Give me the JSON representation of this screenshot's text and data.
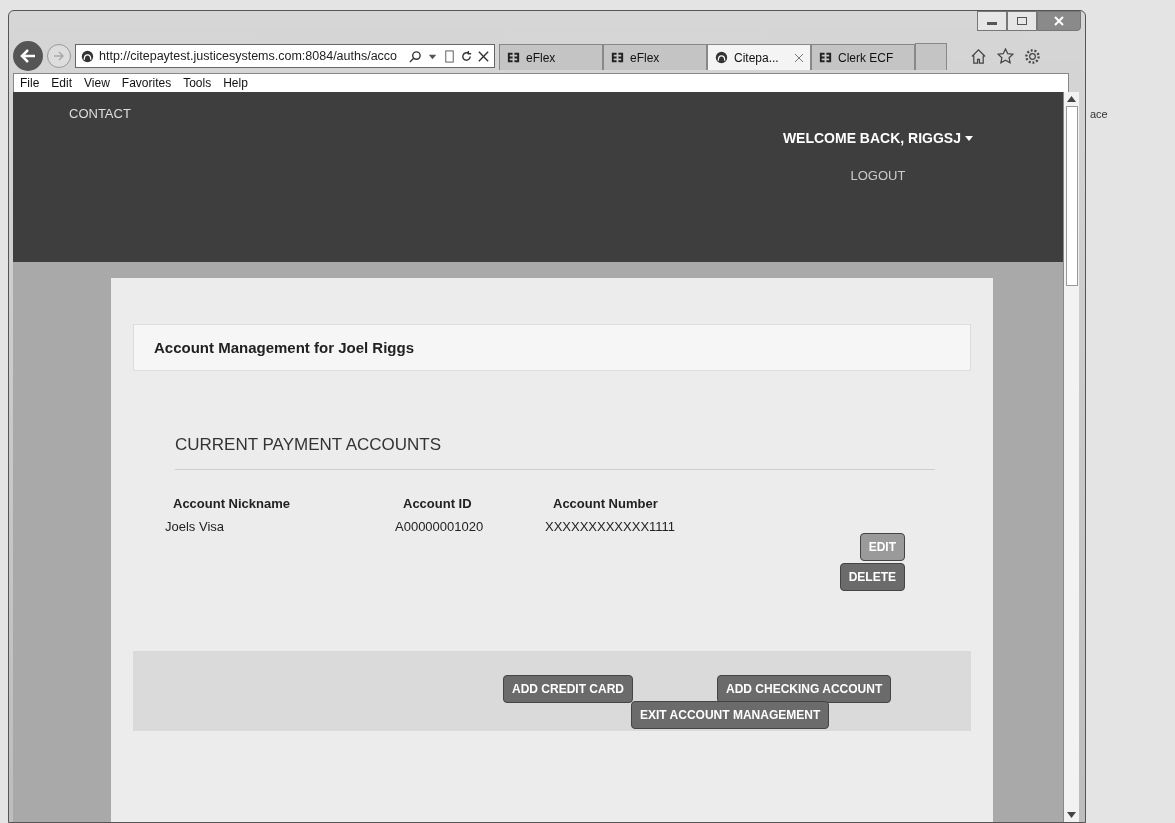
{
  "browser": {
    "address": "http://citepaytest.justicesystems.com:8084/auths/acco",
    "tabs": [
      {
        "label": "eFlex",
        "kind": "eflex",
        "selected": false
      },
      {
        "label": "eFlex",
        "kind": "eflex",
        "selected": false
      },
      {
        "label": "Citepa...",
        "kind": "globe",
        "selected": true
      },
      {
        "label": "Clerk ECF",
        "kind": "eflex",
        "selected": false
      }
    ],
    "menu": [
      "File",
      "Edit",
      "View",
      "Favorites",
      "Tools",
      "Help"
    ]
  },
  "background_window": {
    "text": "ace"
  },
  "header": {
    "nav_link": "CONTACT",
    "user_menu": "WELCOME BACK, RIGGSJ",
    "logout": "LOGOUT"
  },
  "card": {
    "title": "Account Management for Joel Riggs",
    "section_heading": "CURRENT PAYMENT ACCOUNTS",
    "table": {
      "columns": [
        "Account Nickname",
        "Account ID",
        "Account Number"
      ],
      "rows": [
        {
          "cells": [
            "Joels Visa",
            "A00000001020",
            "XXXXXXXXXXXX1111"
          ],
          "actions": [
            "EDIT",
            "DELETE"
          ]
        }
      ]
    },
    "footer_buttons": [
      "ADD CREDIT CARD",
      "ADD CHECKING ACCOUNT",
      "EXIT ACCOUNT MANAGEMENT"
    ]
  }
}
